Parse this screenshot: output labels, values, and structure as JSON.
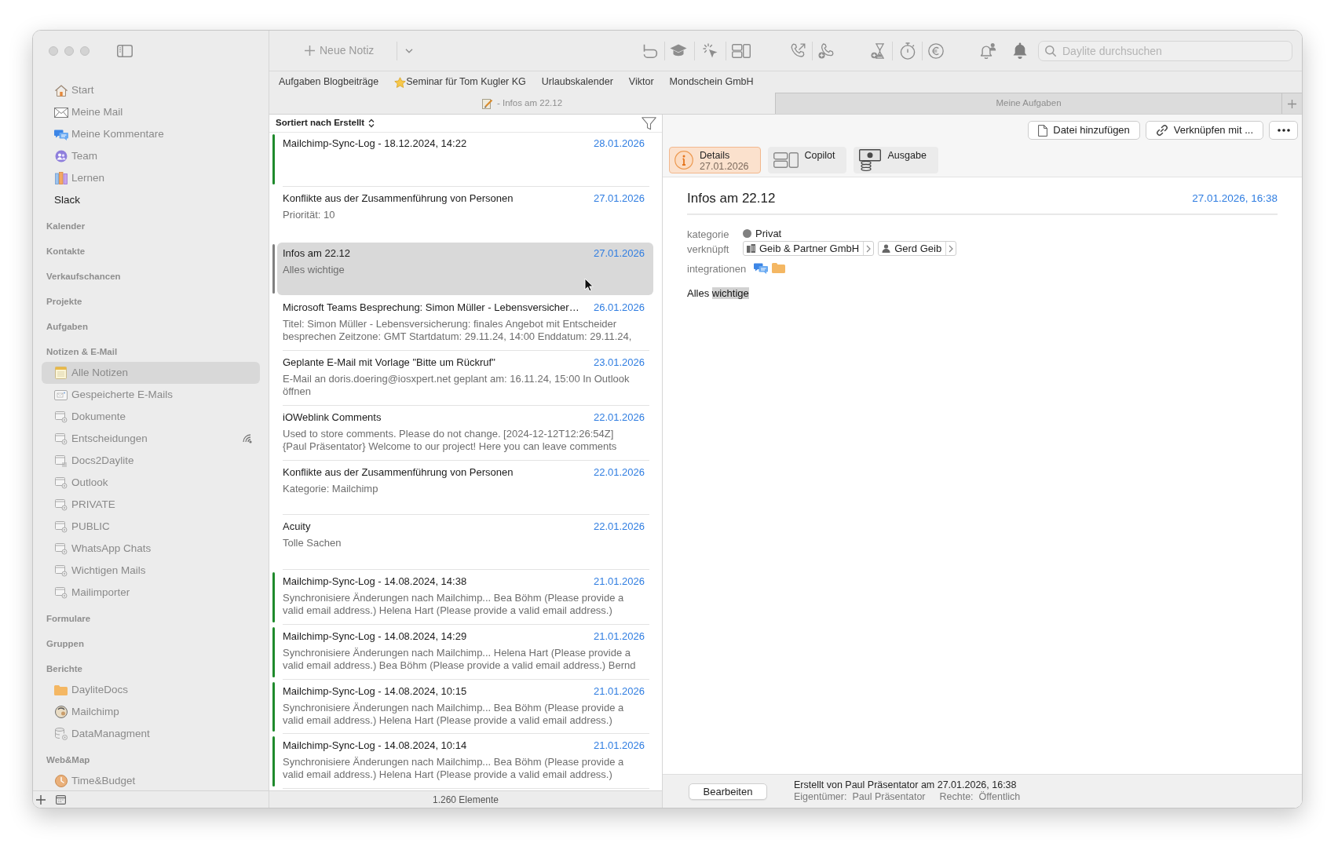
{
  "sidebar": {
    "shortcuts": [
      {
        "label": "Start",
        "kind": "shortcut",
        "selected": false
      },
      {
        "label": "Meine Mail",
        "kind": "shortcut",
        "selected": false
      },
      {
        "label": "Meine Kommentare",
        "kind": "shortcut",
        "selected": false
      },
      {
        "label": "Team",
        "kind": "shortcut",
        "selected": false
      },
      {
        "label": "Lernen",
        "kind": "shortcut",
        "selected": false
      },
      {
        "label": "Slack",
        "kind": "link",
        "selected": false
      }
    ],
    "sections": [
      {
        "title": "Kalender"
      },
      {
        "title": "Kontakte"
      },
      {
        "title": "Verkaufschancen"
      },
      {
        "title": "Projekte"
      },
      {
        "title": "Aufgaben"
      },
      {
        "title": "Notizen & E-Mail",
        "items": [
          {
            "label": "Alle Notizen",
            "selected": true,
            "synced": false
          },
          {
            "label": "Gespeicherte E-Mails",
            "selected": false,
            "synced": false
          },
          {
            "label": "Dokumente",
            "selected": false,
            "synced": false
          },
          {
            "label": "Entscheidungen",
            "selected": false,
            "synced": true
          },
          {
            "label": "Docs2Daylite",
            "selected": false,
            "synced": false
          },
          {
            "label": "Outlook",
            "selected": false,
            "synced": false
          },
          {
            "label": "PRIVATE",
            "selected": false,
            "synced": false
          },
          {
            "label": "PUBLIC",
            "selected": false,
            "synced": false
          },
          {
            "label": "WhatsApp Chats",
            "selected": false,
            "synced": false
          },
          {
            "label": "Wichtigen Mails",
            "selected": false,
            "synced": false
          },
          {
            "label": "Mailimporter",
            "selected": false,
            "synced": false
          }
        ]
      },
      {
        "title": "Formulare"
      },
      {
        "title": "Gruppen"
      },
      {
        "title": "Berichte",
        "items": [
          {
            "label": "DayliteDocs",
            "selected": false
          },
          {
            "label": "Mailchimp",
            "selected": false
          },
          {
            "label": "DataManagment",
            "selected": false
          }
        ]
      },
      {
        "title": "Web&Map",
        "items": [
          {
            "label": "Time&Budget",
            "selected": false
          }
        ]
      }
    ]
  },
  "toolbar": {
    "new_button": "Neue Notiz",
    "search": {
      "placeholder": "Daylite durchsuchen"
    }
  },
  "favorites": [
    {
      "label": "Aufgaben Blogbeiträge",
      "starred": false
    },
    {
      "label": "Seminar für Tom Kugler KG",
      "starred": true
    },
    {
      "label": "Urlaubskalender",
      "starred": false
    },
    {
      "label": "Viktor",
      "starred": false
    },
    {
      "label": "Mondschein GmbH",
      "starred": false
    }
  ],
  "tabs": [
    {
      "label": "- Infos am 22.12",
      "kind": "note",
      "selected": true
    },
    {
      "label": "Meine Aufgaben",
      "kind": "view",
      "selected": false
    }
  ],
  "note_list": {
    "sort_label": "Sortiert nach Erstellt",
    "notes": [
      {
        "title": "Mailchimp-Sync-Log - 18.12.2024, 14:22",
        "date": "28.01.2026",
        "selected": false,
        "color": "#1f8a2c"
      },
      {
        "title": "Konflikte aus der Zusammenführung von Personen",
        "date": "27.01.2026",
        "preview": [
          "Priorität: 10"
        ],
        "selected": false
      },
      {
        "title": "Infos am 22.12",
        "date": "27.01.2026",
        "preview": [
          "Alles wichtige"
        ],
        "selected": true,
        "color": "#808080"
      },
      {
        "title": "Microsoft Teams Besprechung: Simon Müller - Lebensversicher…",
        "date": "26.01.2026",
        "preview": [
          "Titel: Simon Müller - Lebensversicherung: finales Angebot mit Entscheider",
          "besprechen Zeitzone: GMT Startdatum: 29.11.24, 14:00 Enddatum: 29.11.24,"
        ],
        "selected": false
      },
      {
        "title": "Geplante E-Mail mit Vorlage \"Bitte um Rückruf\"",
        "date": "23.01.2026",
        "preview": [
          "E-Mail an doris.doering@iosxpert.net geplant am: 16.11.24, 15:00 In Outlook",
          "öffnen"
        ],
        "selected": false
      },
      {
        "title": "iOWeblink Comments",
        "date": "22.01.2026",
        "preview": [
          "Used to store comments. Please do not change. [2024-12-12T12:26:54Z]",
          "{Paul Präsentator} Welcome to our project! Here you can leave comments"
        ],
        "selected": false
      },
      {
        "title": "Konflikte aus der Zusammenführung von Personen",
        "date": "22.01.2026",
        "preview": [
          "Kategorie: Mailchimp"
        ],
        "selected": false
      },
      {
        "title": "Acuity",
        "date": "22.01.2026",
        "preview": [
          "Tolle Sachen"
        ],
        "selected": false
      },
      {
        "title": "Mailchimp-Sync-Log - 14.08.2024, 14:38",
        "date": "21.01.2026",
        "preview": [
          "Synchronisiere Änderungen nach Mailchimp... Bea Böhm (Please provide a",
          "valid email address.) Helena Hart (Please provide a valid email address.)"
        ],
        "selected": false,
        "color": "#1f8a2c"
      },
      {
        "title": "Mailchimp-Sync-Log - 14.08.2024, 14:29",
        "date": "21.01.2026",
        "preview": [
          "Synchronisiere Änderungen nach Mailchimp... Helena Hart (Please provide a",
          "valid email address.) Bea Böhm (Please provide a valid email address.) Bernd"
        ],
        "selected": false,
        "color": "#1f8a2c"
      },
      {
        "title": "Mailchimp-Sync-Log - 14.08.2024, 10:15",
        "date": "21.01.2026",
        "preview": [
          "Synchronisiere Änderungen nach Mailchimp... Bea Böhm (Please provide a",
          "valid email address.) Helena Hart (Please provide a valid email address.)"
        ],
        "selected": false,
        "color": "#1f8a2c"
      },
      {
        "title": "Mailchimp-Sync-Log - 14.08.2024, 10:14",
        "date": "21.01.2026",
        "preview": [
          "Synchronisiere Änderungen nach Mailchimp... Bea Böhm (Please provide a",
          "valid email address.) Helena Hart (Please provide a valid email address.)"
        ],
        "selected": false,
        "color": "#1f8a2c"
      }
    ],
    "count": "1.260 Elemente"
  },
  "detail": {
    "actions": [
      "Datei hinzufügen",
      "Verknüpfen mit ..."
    ],
    "panels": [
      {
        "label": "Details",
        "subtitle": "27.01.2026",
        "selected": true
      },
      {
        "label": "Copilot",
        "selected": false
      },
      {
        "label": "Ausgabe",
        "selected": false
      }
    ],
    "title": "Infos am 22.12",
    "date": "27.01.2026, 16:38",
    "fields": [
      {
        "kind": "category",
        "label": "kategorie",
        "value": "Privat",
        "color": "#808080"
      },
      {
        "kind": "links",
        "label": "verknüpft",
        "links": [
          {
            "kind": "company",
            "label": "Geib & Partner GmbH"
          },
          {
            "kind": "person",
            "label": "Gerd Geib"
          }
        ]
      },
      {
        "kind": "integrations",
        "label": "integrationen"
      }
    ],
    "body": [
      {
        "text": "Alles ",
        "highlighted": false
      },
      {
        "text": "wichtige",
        "highlighted": true
      }
    ],
    "footer": {
      "edit_button": "Bearbeiten",
      "created": "Erstellt von Paul Präsentator am 27.01.2026, 16:38",
      "owner_label": "Eigentümer:",
      "owner": "Paul Präsentator",
      "rights_label": "Rechte:",
      "rights": "Öffentlich"
    }
  }
}
